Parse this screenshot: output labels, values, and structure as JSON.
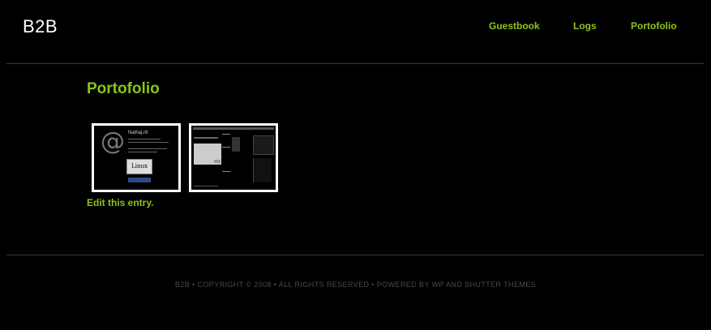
{
  "site": {
    "title": "B2B"
  },
  "nav": {
    "items": [
      "Guestbook",
      "Logs",
      "Portofolio"
    ]
  },
  "page": {
    "title": "Portofolio",
    "edit_link": "Edit this entry."
  },
  "thumbnails": [
    {
      "icon": "at-sign-icon",
      "title_text": "Nathaj.r8",
      "badge": "Linux"
    },
    {
      "icon": "website-screenshot-icon"
    }
  ],
  "footer": {
    "text": "B2B • COPYRIGHT © 2008 • ALL RIGHTS RESERVED • POWERED BY WP AND SHUTTER THEMES"
  },
  "colors": {
    "accent": "#8cc41a",
    "background": "#000000",
    "divider": "#3a3a3a"
  }
}
